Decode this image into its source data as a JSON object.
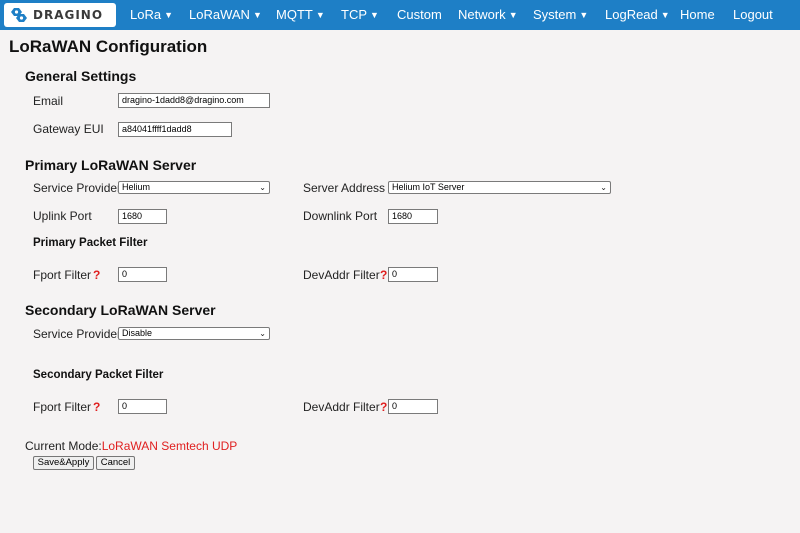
{
  "brand": {
    "name": "DRAGINO",
    "logo_color": "#1e7fc6"
  },
  "nav": {
    "items": [
      {
        "label": "LoRa",
        "dropdown": true
      },
      {
        "label": "LoRaWAN",
        "dropdown": true
      },
      {
        "label": "MQTT",
        "dropdown": true
      },
      {
        "label": "TCP",
        "dropdown": true
      },
      {
        "label": "Custom",
        "dropdown": false
      },
      {
        "label": "Network",
        "dropdown": true
      },
      {
        "label": "System",
        "dropdown": true
      },
      {
        "label": "LogRead",
        "dropdown": true
      },
      {
        "label": "Home",
        "dropdown": false
      },
      {
        "label": "Logout",
        "dropdown": false
      }
    ],
    "caret": "▼"
  },
  "page": {
    "title": "LoRaWAN Configuration"
  },
  "general": {
    "title": "General Settings",
    "email_label": "Email",
    "email_value": "dragino-1dadd8@dragino.com",
    "eui_label": "Gateway EUI",
    "eui_value": "a84041ffff1dadd8"
  },
  "primary": {
    "title": "Primary LoRaWAN Server",
    "provider_label": "Service Provider",
    "provider_value": "Helium",
    "address_label": "Server Address",
    "address_value": "Helium IoT Server",
    "uplink_label": "Uplink Port",
    "uplink_value": "1680",
    "downlink_label": "Downlink Port",
    "downlink_value": "1680",
    "filter_title": "Primary Packet Filter",
    "fport_label": "Fport Filter",
    "fport_value": "0",
    "devaddr_label": "DevAddr Filter",
    "devaddr_value": "0"
  },
  "secondary": {
    "title": "Secondary LoRaWAN Server",
    "provider_label": "Service Provider",
    "provider_value": "Disable",
    "filter_title": "Secondary Packet Filter",
    "fport_label": "Fport Filter",
    "fport_value": "0",
    "devaddr_label": "DevAddr Filter",
    "devaddr_value": "0"
  },
  "help_mark": "?",
  "status": {
    "mode_label": "Current Mode:",
    "mode_value": "LoRaWAN Semtech UDP"
  },
  "buttons": {
    "save": "Save&Apply",
    "cancel": "Cancel"
  },
  "colors": {
    "nav_bg": "#1e7fc6",
    "page_bg": "#f5f3f3",
    "accent_red": "#e02020"
  }
}
